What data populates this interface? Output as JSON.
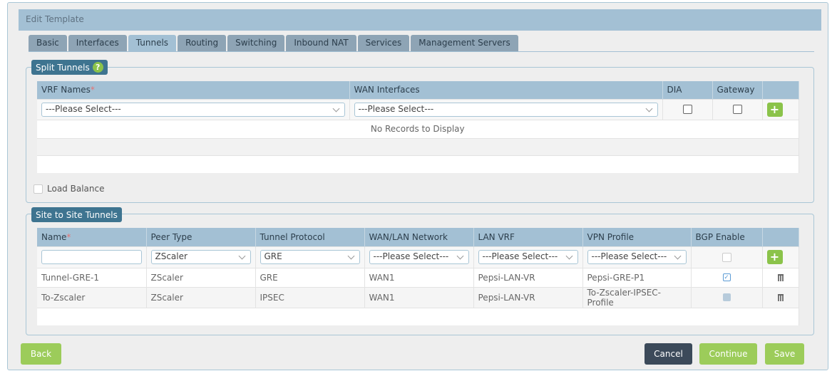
{
  "header": {
    "title": "Edit Template"
  },
  "tabs": [
    {
      "label": "Basic"
    },
    {
      "label": "Interfaces"
    },
    {
      "label": "Tunnels",
      "active": true
    },
    {
      "label": "Routing"
    },
    {
      "label": "Switching"
    },
    {
      "label": "Inbound NAT"
    },
    {
      "label": "Services"
    },
    {
      "label": "Management Servers"
    }
  ],
  "split": {
    "legend": "Split Tunnels",
    "help": "?",
    "columns": [
      "VRF Names",
      "WAN Interfaces",
      "DIA",
      "Gateway"
    ],
    "required": "*",
    "vrf_select": "---Please Select---",
    "wan_select": "---Please Select---",
    "empty": "No Records to Display",
    "plus": "+",
    "load_balance": "Load Balance"
  },
  "site": {
    "legend": "Site to Site Tunnels",
    "columns": [
      "Name",
      "Peer Type",
      "Tunnel Protocol",
      "WAN/LAN Network",
      "LAN VRF",
      "VPN Profile",
      "BGP Enable"
    ],
    "required": "*",
    "new_row": {
      "name": "",
      "peer": "ZScaler",
      "protocol": "GRE",
      "network": "---Please Select---",
      "vrf": "---Please Select---",
      "profile": "---Please Select---"
    },
    "plus": "+",
    "rows": [
      {
        "name": "Tunnel-GRE-1",
        "peer": "ZScaler",
        "protocol": "GRE",
        "network": "WAN1",
        "vrf": "Pepsi-LAN-VR",
        "profile": "Pepsi-GRE-P1",
        "bgp": true
      },
      {
        "name": "To-Zscaler",
        "peer": "ZScaler",
        "protocol": "IPSEC",
        "network": "WAN1",
        "vrf": "Pepsi-LAN-VR",
        "profile": "To-Zscaler-IPSEC-Profile",
        "bgp": false
      }
    ]
  },
  "buttons": {
    "back": "Back",
    "cancel": "Cancel",
    "continue": "Continue",
    "save": "Save"
  }
}
